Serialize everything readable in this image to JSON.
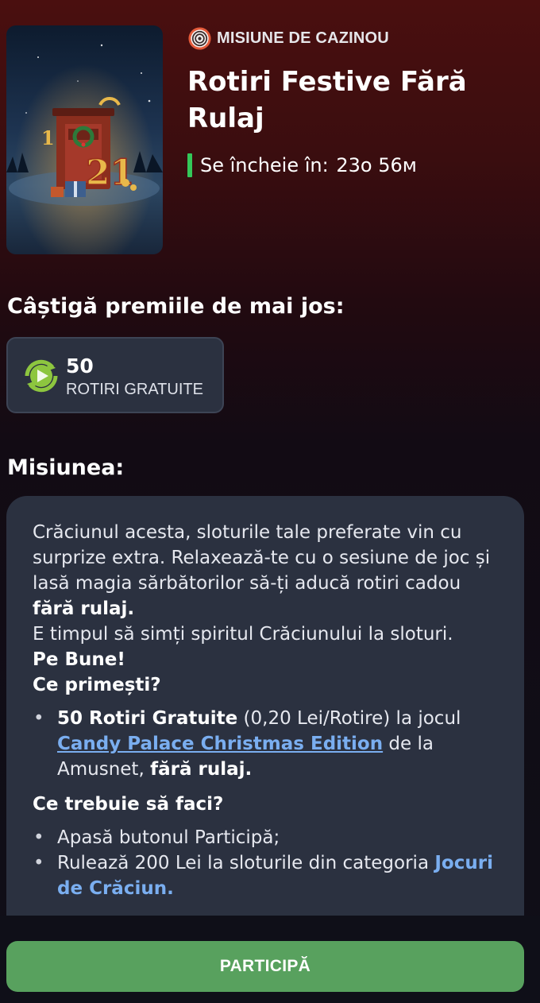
{
  "mission": {
    "tag_label": "MISIUNE DE CAZINOU",
    "title": "Rotiri Festive Fără Rulaj",
    "timer_label": "Se încheie în:",
    "timer_value": "23ᴏ 56ᴍ"
  },
  "prizes": {
    "heading": "Câștigă premiile de mai jos:",
    "items": [
      {
        "amount": "50",
        "type": "ROTIRI GRATUITE",
        "icon": "free-spins-icon"
      }
    ]
  },
  "description": {
    "heading": "Misiunea:",
    "intro_1": "Crăciunul acesta, sloturile tale preferate vin cu surprize extra. Relaxează-te cu o sesiune de joc și lasă magia sărbătorilor să-ți aducă rotiri cadou ",
    "intro_1_bold": "fără rulaj.",
    "intro_2": "E timpul să simți spiritul Crăciunului la sloturi.",
    "intro_2_bold": "Pe Bune!",
    "what_you_get_heading": "Ce primești?",
    "benefit": {
      "bold": "50 Rotiri Gratuite",
      "text_1": " (0,20 Lei/Rotire) la jocul ",
      "game_link": "Candy Palace Christmas Edition",
      "text_2": " de la Amusnet, ",
      "bold_end": "fără rulaj."
    },
    "what_to_do_heading": "Ce trebuie să faci?",
    "steps": [
      {
        "text": "Apasă butonul Participă;"
      },
      {
        "text": "Rulează 200 Lei la sloturile din categoria ",
        "link": "Jocuri de Crăciun."
      }
    ]
  },
  "cta": {
    "label": "PARTICIPĂ"
  },
  "colors": {
    "accent_green": "#58a15e",
    "timer_green": "#34c759",
    "link_blue": "#7aaef0",
    "card_bg": "#2b3140",
    "top_bg": "#4a0f0f"
  }
}
